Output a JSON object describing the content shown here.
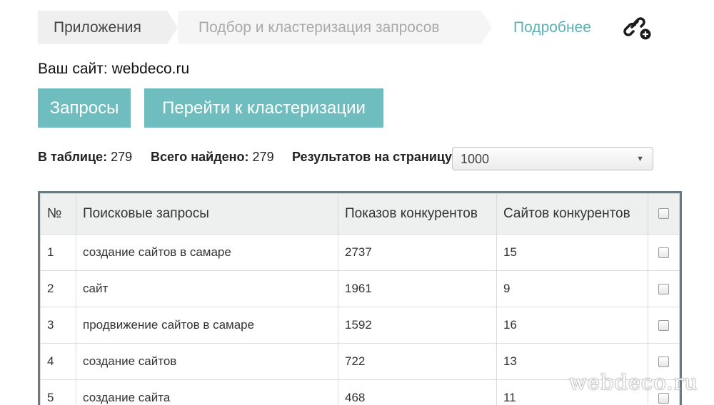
{
  "breadcrumb": {
    "items": [
      "Приложения",
      "Подбор и кластеризация запросов"
    ]
  },
  "more_link": "Подробнее",
  "icons": {
    "link_add": "link-add-icon"
  },
  "site": {
    "label": "Ваш сайт:",
    "value": "webdeco.ru"
  },
  "buttons": {
    "queries": "Запросы",
    "cluster": "Перейти к кластеризации"
  },
  "stats": {
    "in_table_label": "В таблице:",
    "in_table_value": "279",
    "total_label": "Всего найдено:",
    "total_value": "279",
    "per_page_label": "Результатов на страницу:",
    "per_page_value": "1000"
  },
  "table": {
    "headers": [
      "№",
      "Поисковые запросы",
      "Показов конкурентов",
      "Сайтов конкурентов"
    ],
    "rows": [
      [
        "1",
        "создание сайтов в самаре",
        "2737",
        "15"
      ],
      [
        "2",
        "сайт",
        "1961",
        "9"
      ],
      [
        "3",
        "продвижение сайтов в самаре",
        "1592",
        "16"
      ],
      [
        "4",
        "создание сайтов",
        "722",
        "13"
      ],
      [
        "5",
        "создание сайта",
        "468",
        "11"
      ]
    ]
  },
  "watermark": "webdeco.ru",
  "colors": {
    "accent": "#6fbdbe",
    "link": "#5ab0b3",
    "table_border": "#6b7a80"
  }
}
